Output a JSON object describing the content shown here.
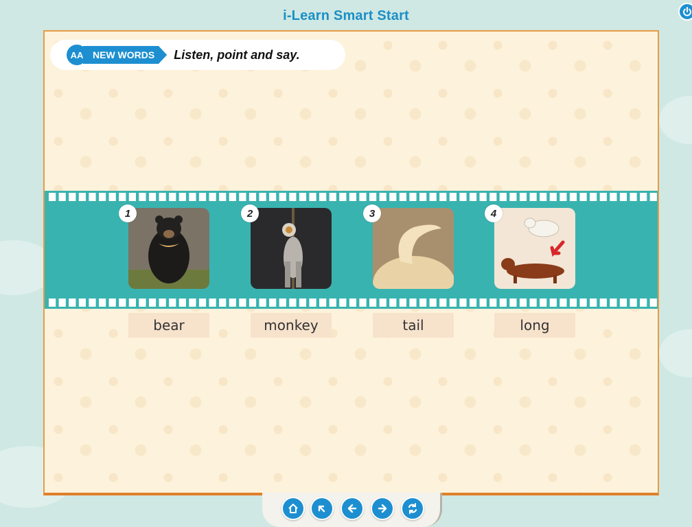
{
  "app": {
    "title": "i-Learn Smart Start"
  },
  "header": {
    "icon": "aa-letters-icon",
    "icon_text": "AA",
    "tag_label": "NEW WORDS",
    "instruction": "Listen, point and say."
  },
  "cards": [
    {
      "number": "1",
      "word": "bear",
      "image": "sun-bear-photo"
    },
    {
      "number": "2",
      "word": "monkey",
      "image": "langur-monkey-photo"
    },
    {
      "number": "3",
      "word": "tail",
      "image": "dog-tail-photo"
    },
    {
      "number": "4",
      "word": "long",
      "image": "dachshund-photo"
    }
  ],
  "nav": {
    "buttons": [
      "home-icon",
      "back-to-top-icon",
      "previous-icon",
      "next-icon",
      "replay-icon"
    ]
  },
  "colors": {
    "accent": "#1d8fd1",
    "film": "#39b3b0",
    "stage_bg": "#fdf3dc",
    "stage_border": "#e79b44",
    "word_bg": "#f7e2cc"
  }
}
